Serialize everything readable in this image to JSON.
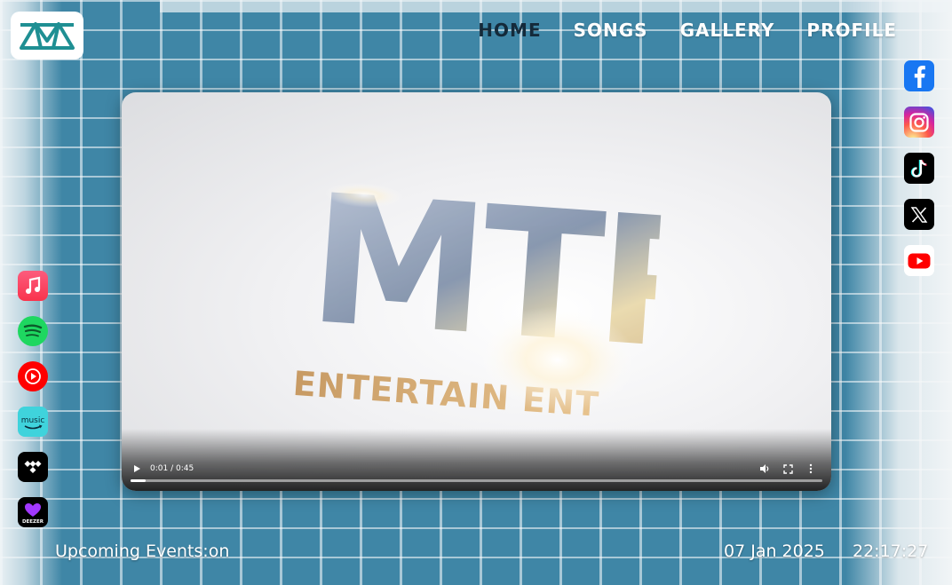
{
  "nav": {
    "items": [
      {
        "label": "HOME",
        "active": true
      },
      {
        "label": "SONGS",
        "active": false
      },
      {
        "label": "GALLERY",
        "active": false
      },
      {
        "label": "PROFILE",
        "active": false
      }
    ]
  },
  "logo": {
    "icon": "mtm-logo-icon",
    "color": "#1f8f93"
  },
  "video": {
    "brand_big": "MTP",
    "brand_small": "ENTERTAIN  ENT",
    "time": "0:01 / 0:45",
    "progress_fraction": 0.022
  },
  "streaming": [
    {
      "icon": "apple-music-icon",
      "color": "#fa3f5b"
    },
    {
      "icon": "spotify-icon",
      "color": "#1ed760"
    },
    {
      "icon": "youtube-music-icon",
      "color": "#ff0000"
    },
    {
      "icon": "amazon-music-icon",
      "color": "#25d1da",
      "text": "music"
    },
    {
      "icon": "tidal-icon",
      "color": "#000000"
    },
    {
      "icon": "deezer-icon",
      "color": "#a238ff",
      "text": "DEEZER"
    }
  ],
  "social": [
    {
      "icon": "facebook-icon",
      "color": "#1877f2"
    },
    {
      "icon": "instagram-icon",
      "color": "#e1306c"
    },
    {
      "icon": "tiktok-icon",
      "color": "#000000"
    },
    {
      "icon": "x-icon",
      "color": "#000000"
    },
    {
      "icon": "youtube-icon",
      "color": "#ff0000"
    }
  ],
  "footer": {
    "ticker": "Upcoming Events:on",
    "date": "07 Jan 2025",
    "time": "22:17:27"
  }
}
